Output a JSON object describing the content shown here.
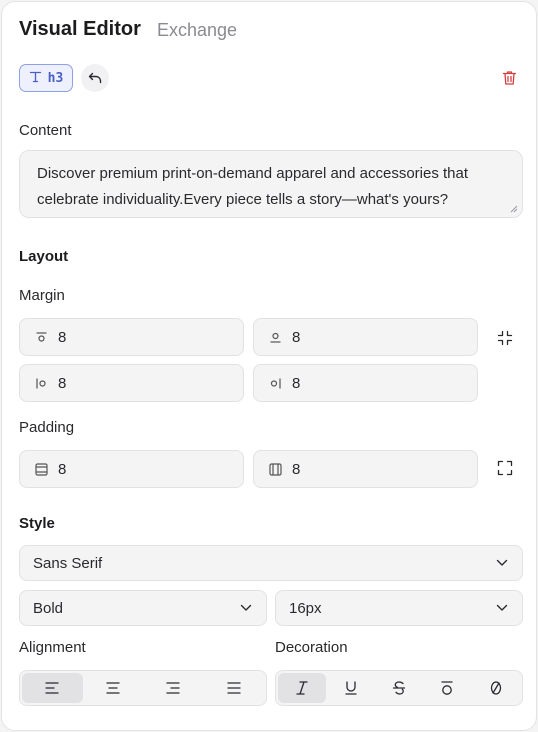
{
  "header": {
    "tab_active": "Visual Editor",
    "tab_inactive": "Exchange"
  },
  "toolbar": {
    "tag_label": "h3",
    "tag_icon": "type-icon",
    "undo_icon": "undo-icon",
    "delete_icon": "trash-icon",
    "delete_color": "#d23f3f",
    "accent": "#4b5fc6"
  },
  "content": {
    "label": "Content",
    "text": "Discover premium print-on-demand apparel and accessories that celebrate individuality.Every piece tells a story—what's yours?"
  },
  "layout": {
    "title": "Layout",
    "margin": {
      "label": "Margin",
      "top": "8",
      "bottom": "8",
      "left": "8",
      "right": "8"
    },
    "padding": {
      "label": "Padding",
      "vertical": "8",
      "horizontal": "8"
    }
  },
  "style": {
    "title": "Style",
    "font_family": "Sans Serif",
    "font_weight": "Bold",
    "font_size": "16px",
    "alignment_label": "Alignment",
    "alignment_selected": "left",
    "decoration_label": "Decoration",
    "decoration_selected": "italic"
  }
}
